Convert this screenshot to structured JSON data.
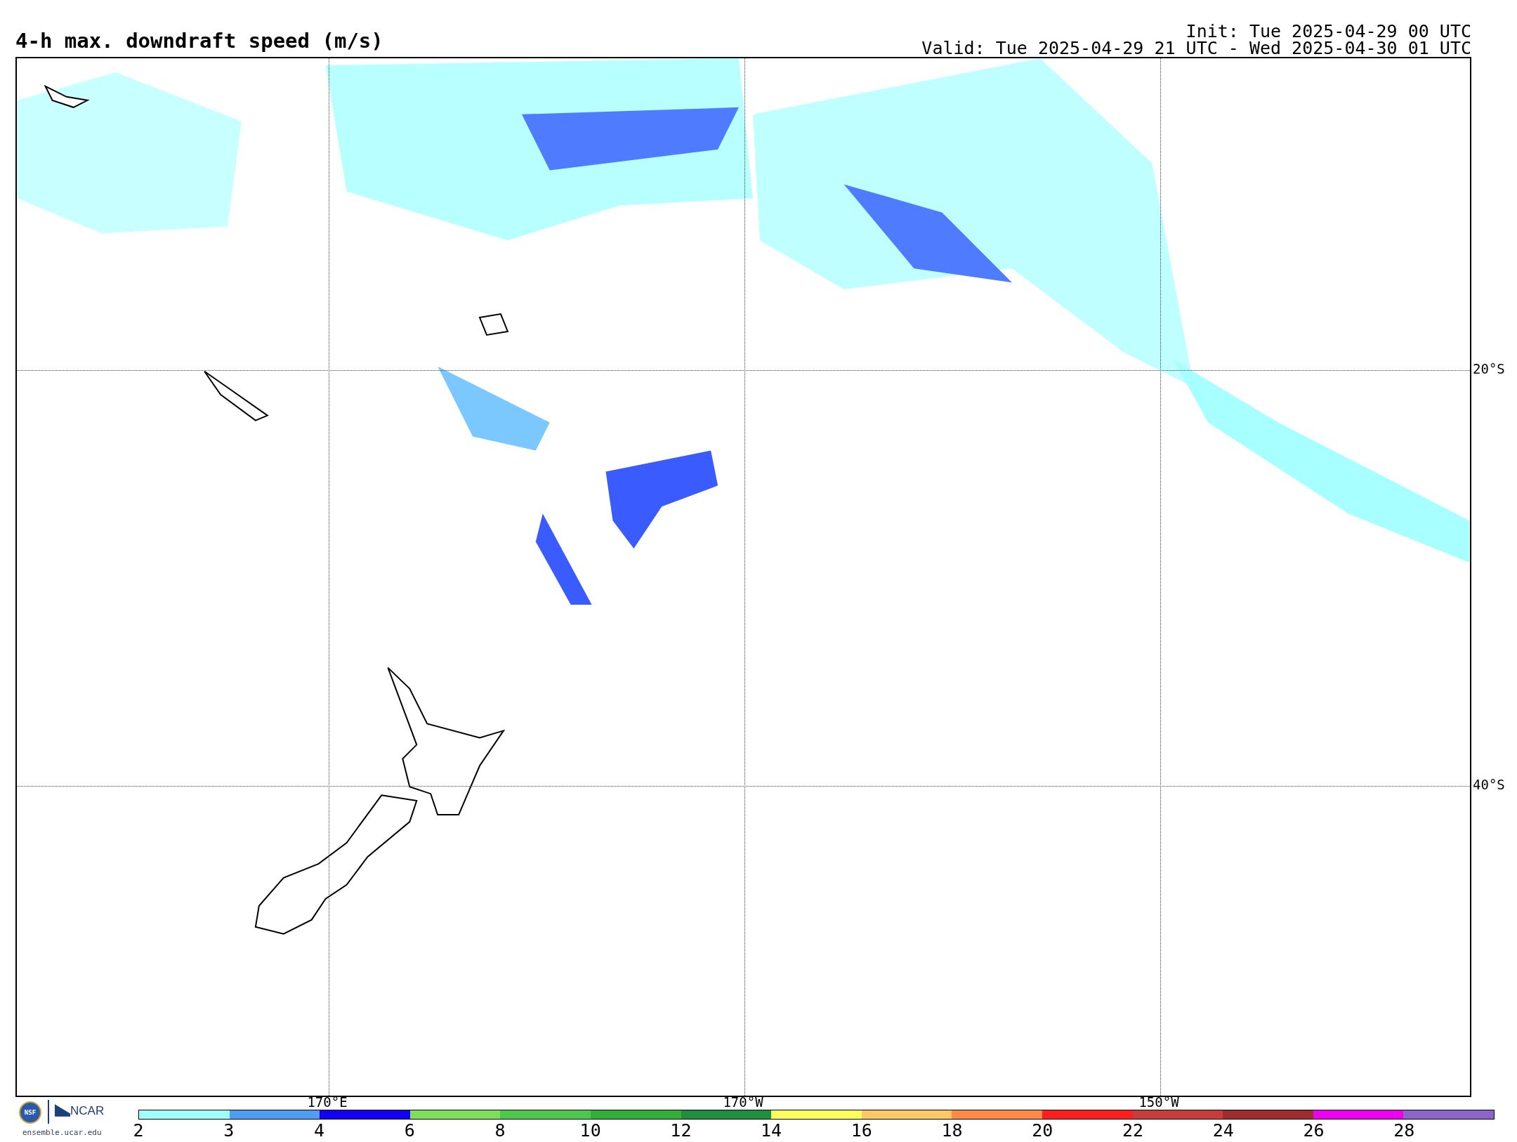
{
  "title": "4-h max. downdraft speed (m/s)",
  "init": "Init: Tue 2025-04-29 00 UTC",
  "valid": "Valid: Tue 2025-04-29 21 UTC - Wed 2025-04-30 01 UTC",
  "map": {
    "longitude_labels": [
      "170°E",
      "170°W",
      "150°W"
    ],
    "latitude_labels": [
      "20°S",
      "40°S"
    ]
  },
  "colorbar": {
    "segments": [
      {
        "color": "#a0ffff"
      },
      {
        "color": "#4f9cf5"
      },
      {
        "color": "#1400f5"
      },
      {
        "color": "#7ee05a"
      },
      {
        "color": "#4bc94b"
      },
      {
        "color": "#31b038"
      },
      {
        "color": "#1e8f3c"
      },
      {
        "color": "#ffff5a"
      },
      {
        "color": "#ffc864"
      },
      {
        "color": "#ff8a46"
      },
      {
        "color": "#ff1e1e"
      },
      {
        "color": "#c83c3c"
      },
      {
        "color": "#a02d2d"
      },
      {
        "color": "#f000f0"
      },
      {
        "color": "#8c64cc"
      }
    ],
    "tick_labels": [
      "2",
      "3",
      "4",
      "6",
      "8",
      "10",
      "12",
      "14",
      "16",
      "18",
      "20",
      "22",
      "24",
      "26",
      "28"
    ]
  },
  "credit": {
    "seal_text": "NSF",
    "logo_text": "NCAR",
    "url": "ensemble.ucar.edu"
  }
}
